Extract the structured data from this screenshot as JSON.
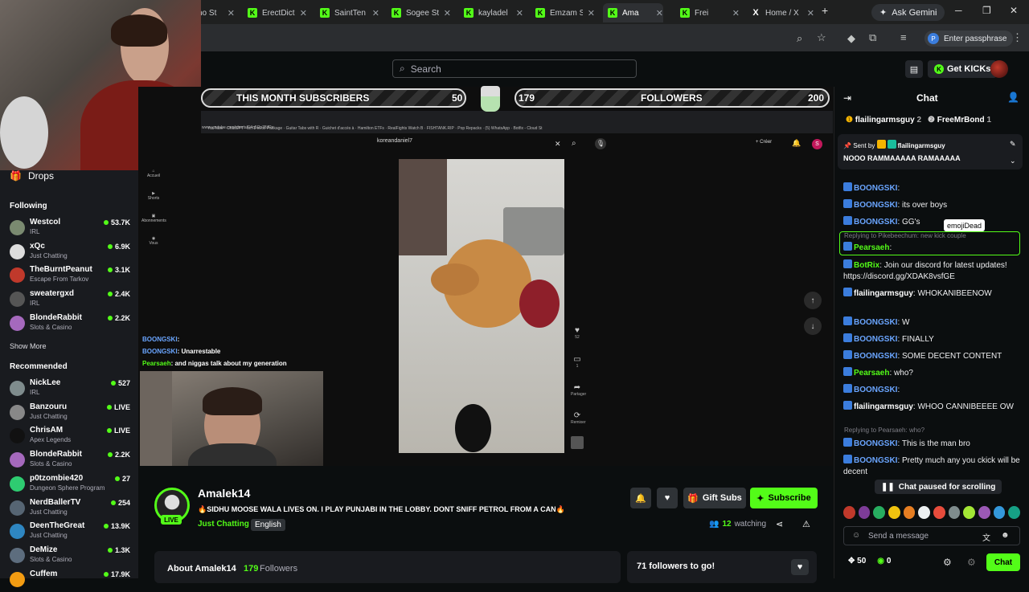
{
  "browser": {
    "tabs": [
      {
        "label": "ho St",
        "icon": "kick-icon",
        "fav": "K"
      },
      {
        "label": "ErectDict",
        "icon": "kick-icon",
        "fav": "K"
      },
      {
        "label": "SaintTen",
        "icon": "kick-icon",
        "fav": "K"
      },
      {
        "label": "Sogee St",
        "icon": "kick-icon",
        "fav": "K"
      },
      {
        "label": "kayladel",
        "icon": "kick-icon",
        "fav": "K"
      },
      {
        "label": "Emzam S",
        "icon": "kick-icon",
        "fav": "K"
      },
      {
        "label": "Ama",
        "icon": "kick-icon",
        "fav": "K"
      },
      {
        "label": "Frei",
        "icon": "kick-icon",
        "fav": "K"
      },
      {
        "label": "Home / X",
        "icon": "x-icon",
        "fav": "X"
      }
    ],
    "gemini_label": "Ask Gemini",
    "passphrase_label": "Enter passphrase"
  },
  "header": {
    "search_placeholder": "Search",
    "get_kicks_label": "Get KICKs"
  },
  "sidebar": {
    "drops_label": "Drops",
    "following_heading": "Following",
    "following": [
      {
        "name": "Westcol",
        "category": "IRL",
        "viewers": "53.7K",
        "color": "#7a8a70"
      },
      {
        "name": "xQc",
        "category": "Just Chatting",
        "viewers": "6.9K",
        "color": "#dddddd"
      },
      {
        "name": "TheBurntPeanut",
        "category": "Escape From Tarkov",
        "viewers": "3.1K",
        "color": "#c0392b"
      },
      {
        "name": "sweatergxd",
        "category": "IRL",
        "viewers": "2.4K",
        "color": "#555555"
      },
      {
        "name": "BlondeRabbit",
        "category": "Slots & Casino",
        "viewers": "2.2K",
        "color": "#a569bd"
      }
    ],
    "show_more": "Show More",
    "recommended_heading": "Recommended",
    "recommended": [
      {
        "name": "NickLee",
        "category": "IRL",
        "viewers": "527",
        "color": "#7f8c8d"
      },
      {
        "name": "Banzouru",
        "category": "Just Chatting",
        "viewers": "LIVE",
        "color": "#888888"
      },
      {
        "name": "ChrisAM",
        "category": "Apex Legends",
        "viewers": "LIVE",
        "color": "#111111"
      },
      {
        "name": "BlondeRabbit",
        "category": "Slots & Casino",
        "viewers": "2.2K",
        "color": "#a569bd"
      },
      {
        "name": "p0tzombie420",
        "category": "Dungeon Sphere Program",
        "viewers": "27",
        "color": "#2ecc71"
      },
      {
        "name": "NerdBallerTV",
        "category": "Just Chatting",
        "viewers": "254",
        "color": "#566573"
      },
      {
        "name": "DeenTheGreat",
        "category": "Just Chatting",
        "viewers": "13.9K",
        "color": "#2e86c1"
      },
      {
        "name": "DeMize",
        "category": "Slots & Casino",
        "viewers": "1.3K",
        "color": "#5d6d7e"
      },
      {
        "name": "Cuffem",
        "category": "",
        "viewers": "17.9K",
        "color": "#f39c12"
      }
    ]
  },
  "video": {
    "subs_label": "THIS MONTH SUBSCRIBERS",
    "subs_count": "50",
    "followers_count_bar": "179",
    "followers_label": "FOLLOWERS",
    "followers_goal": "200",
    "yt_search": "koreandaniel7",
    "short_counts": {
      "likes": "52",
      "comments": "1",
      "share": "Partager",
      "remix": "Remixer"
    },
    "overlay_chat": [
      {
        "user": "BOONGSKI",
        "text": ":"
      },
      {
        "user": "BOONGSKI",
        "text": ": Unarrestable"
      },
      {
        "user": "Pearsaeh",
        "text": ": and niggas talk about my generation"
      }
    ]
  },
  "stream": {
    "streamer": "Amalek14",
    "live_label": "LIVE",
    "title": "🔥SIDHU MOOSE WALA LIVES ON.  I PLAY PUNJABI IN THE LOBBY. DONT SNIFF PETROL FROM A CAN🔥",
    "category": "Just Chatting",
    "language": "English",
    "gift_subs_label": "Gift Subs",
    "subscribe_label": "Subscribe",
    "watching_count": "12",
    "watching_label": "watching",
    "about_title": "About Amalek14",
    "about_followers_count": "179",
    "about_followers_label": "Followers",
    "goal_text": "71 followers to go!"
  },
  "chat": {
    "title": "Chat",
    "top": [
      {
        "name": "flailingarmsguy",
        "count": "2"
      },
      {
        "name": "FreeMrBond",
        "count": "1"
      }
    ],
    "pinned_sent_prefix": "Sent by",
    "pinned_user": "flailingarmsguy",
    "pinned_message": "NOOO RAMMAAAAA RAMAAAAA",
    "tooltip": "emojiDead",
    "messages": [
      {
        "user": "BOONGSKI",
        "text": ":",
        "color": "#6aa5ff"
      },
      {
        "user": "BOONGSKI",
        "text": ": its over boys",
        "color": "#6aa5ff"
      },
      {
        "user": "BOONGSKI",
        "text": ": GG's",
        "color": "#6aa5ff"
      },
      {
        "reply": "Replying to Pikebeechum: new kick couple"
      },
      {
        "user": "Pearsaeh",
        "text": ":",
        "color": "#53fc18"
      },
      {
        "user": "BotRix",
        "text": ": Join our discord for latest updates! https://discord.gg/XDAK8vsfGE",
        "color": "#53fc18"
      },
      {
        "user": "flailingarmsguy",
        "text": ": WHOKANIBEENOW",
        "color": "#ffffff"
      },
      {
        "user": "BOONGSKI",
        "text": ": W",
        "color": "#6aa5ff"
      },
      {
        "user": "BOONGSKI",
        "text": ": FINALLY",
        "color": "#6aa5ff"
      },
      {
        "user": "BOONGSKI",
        "text": ": SOME DECENT CONTENT",
        "color": "#6aa5ff"
      },
      {
        "user": "Pearsaeh",
        "text": ": who?",
        "color": "#53fc18"
      },
      {
        "user": "BOONGSKI",
        "text": ":",
        "color": "#6aa5ff"
      },
      {
        "user": "flailingarmsguy",
        "text": ": WHOO CANNIBEEEE OW",
        "color": "#ffffff"
      },
      {
        "reply": "Replying to Pearsaeh: who?"
      },
      {
        "user": "BOONGSKI",
        "text": ": This is the man bro",
        "color": "#6aa5ff"
      },
      {
        "user": "BOONGSKI",
        "text": ": Pretty much any you ckick will be decent",
        "color": "#6aa5ff"
      }
    ],
    "paused_label": "Chat paused for scrolling",
    "input_placeholder": "Send a message",
    "kicks_count": "50",
    "points_count": "0",
    "chat_button": "Chat"
  }
}
